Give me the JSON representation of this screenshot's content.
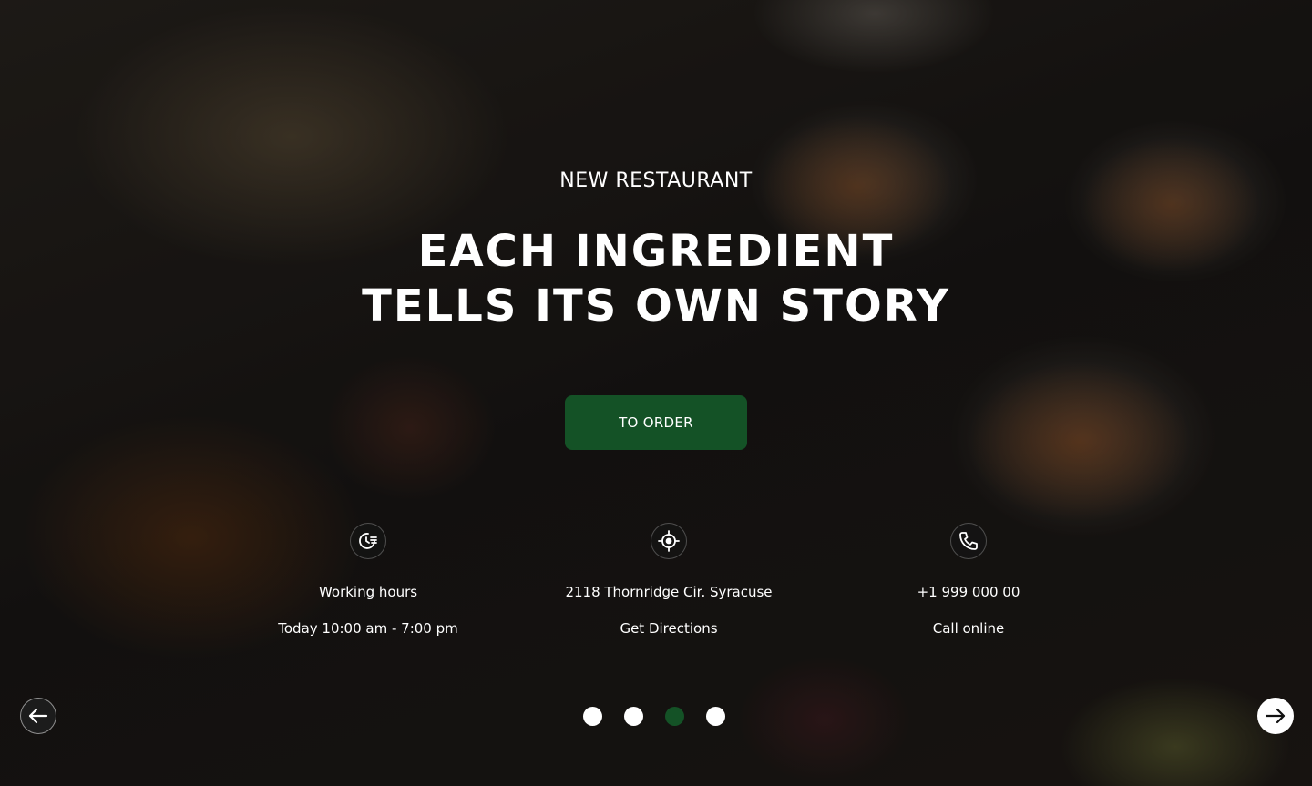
{
  "hero": {
    "subtitle": "NEW RESTAURANT",
    "headline_line1": "EACH INGREDIENT",
    "headline_line2": "TELLS ITS OWN STORY",
    "order_button": "TO ORDER"
  },
  "info": [
    {
      "icon": "clock-icon",
      "line1": "Working hours",
      "line2": "Today 10:00 am - 7:00 pm"
    },
    {
      "icon": "location-icon",
      "line1": "2118 Thornridge Cir. Syracuse",
      "line2": "Get Directions"
    },
    {
      "icon": "phone-icon",
      "line1": "+1 999 000 00",
      "line2": "Call online"
    }
  ],
  "slider": {
    "total_slides": 4,
    "active_index": 3,
    "prev_icon": "arrow-left-icon",
    "next_icon": "arrow-right-icon"
  },
  "colors": {
    "accent": "#145226",
    "text": "#ffffff"
  }
}
